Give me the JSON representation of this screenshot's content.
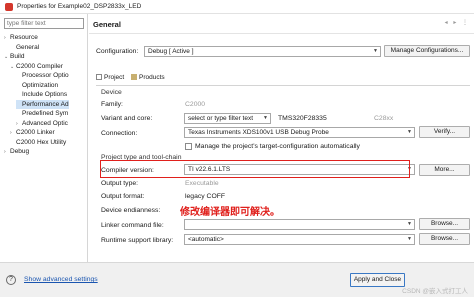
{
  "window": {
    "title": "Properties for Example02_DSP2833x_LED"
  },
  "left": {
    "filter_placeholder": "type filter text",
    "tree": [
      {
        "label": "Resource",
        "twisty": "›"
      },
      {
        "label": "General",
        "twisty": ""
      },
      {
        "label": "Build",
        "twisty": "⌄"
      },
      {
        "label": "C2000 Compiler",
        "twisty": "⌄"
      },
      {
        "label": "Processor Optio",
        "twisty": ""
      },
      {
        "label": "Optimization",
        "twisty": ""
      },
      {
        "label": "Include Options",
        "twisty": ""
      },
      {
        "label": "Performance Ad",
        "twisty": ""
      },
      {
        "label": "Predefined Sym",
        "twisty": ""
      },
      {
        "label": "Advanced Optic",
        "twisty": "›"
      },
      {
        "label": "C2000 Linker",
        "twisty": "›"
      },
      {
        "label": "C2000 Hex Utility",
        "twisty": ""
      },
      {
        "label": "Debug",
        "twisty": "›"
      }
    ]
  },
  "page": {
    "title": "General",
    "configuration_label": "Configuration:",
    "configuration_value": "Debug  [ Active ]",
    "manage_button": "Manage Configurations...",
    "tabs": [
      {
        "label": "Project"
      },
      {
        "label": "Products"
      }
    ],
    "device_section": "Device",
    "family_label": "Family:",
    "family_value": "C2000",
    "variant_label": "Variant and core:",
    "variant_filter": "select or type filter text",
    "variant_value": "TMS320F28335",
    "core_value": "C28xx",
    "connection_label": "Connection:",
    "connection_value": "Texas Instruments XDS100v1 USB Debug Probe",
    "verify_button": "Verify...",
    "manage_target_label": "Manage the project's target-configuration automatically",
    "toolchain_section": "Project type and tool-chain",
    "compiler_label": "Compiler version:",
    "compiler_value": "TI v22.6.1.LTS",
    "more_button": "More...",
    "output_type_label": "Output type:",
    "output_type_value": "Executable",
    "output_format_label": "Output format:",
    "output_format_value": "legacy COFF",
    "endianness_label": "Device endianness:",
    "linker_label": "Linker command file:",
    "browse_button": "Browse...",
    "runtime_label": "Runtime support library:",
    "runtime_value": "<automatic>",
    "annotation": "修改编译器即可解决。"
  },
  "footer": {
    "advanced_link": "Show advanced settings",
    "apply_close_button": "Apply and Close",
    "watermark": "CSDN @嵌入式打工人"
  }
}
